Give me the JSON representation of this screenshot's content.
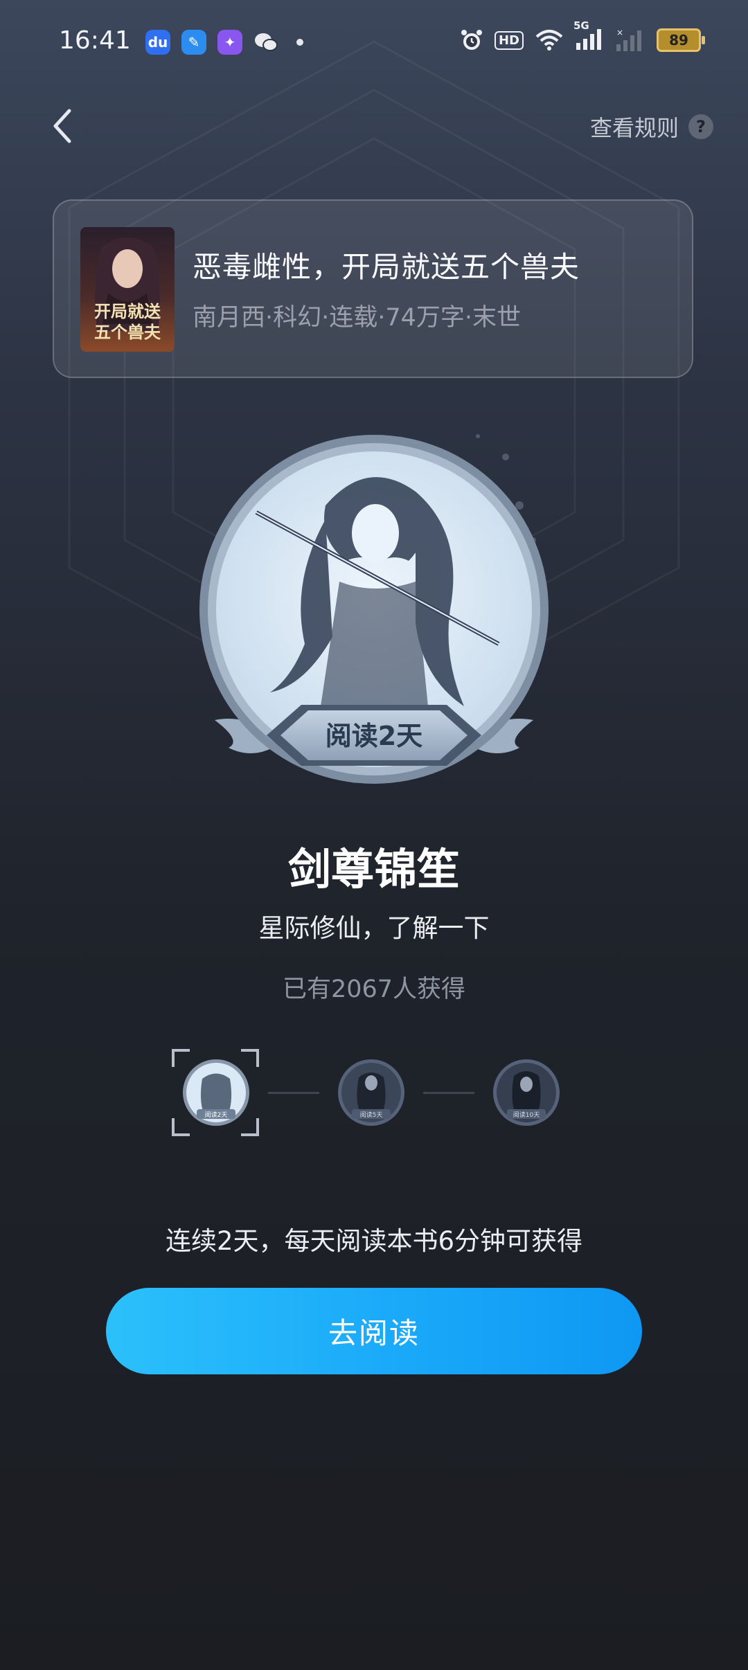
{
  "status_bar": {
    "time": "16:41",
    "hd_label": "HD",
    "network_label": "5G",
    "battery": "89"
  },
  "header": {
    "rules_label": "查看规则",
    "help_glyph": "?"
  },
  "book": {
    "title": "恶毒雌性，开局就送五个兽夫",
    "meta": "南月西·科幻·连载·74万字·末世",
    "cover_text_line1": "开局就送",
    "cover_text_line2": "五个兽夫"
  },
  "badge": {
    "ribbon": "阅读2天",
    "name": "剑尊锦笙",
    "description": "星际修仙，了解一下",
    "owners": "已有2067人获得"
  },
  "progress": {
    "steps": [
      {
        "label": "阅读2天",
        "active": true
      },
      {
        "label": "阅读5天",
        "active": false
      },
      {
        "label": "阅读10天",
        "active": false
      }
    ]
  },
  "requirement": "连续2天，每天阅读本书6分钟可获得",
  "cta_label": "去阅读",
  "colors": {
    "accent": "#1aa9f9",
    "badge_bg": "#d9e8f6",
    "badge_rim": "#8b9bb0"
  }
}
